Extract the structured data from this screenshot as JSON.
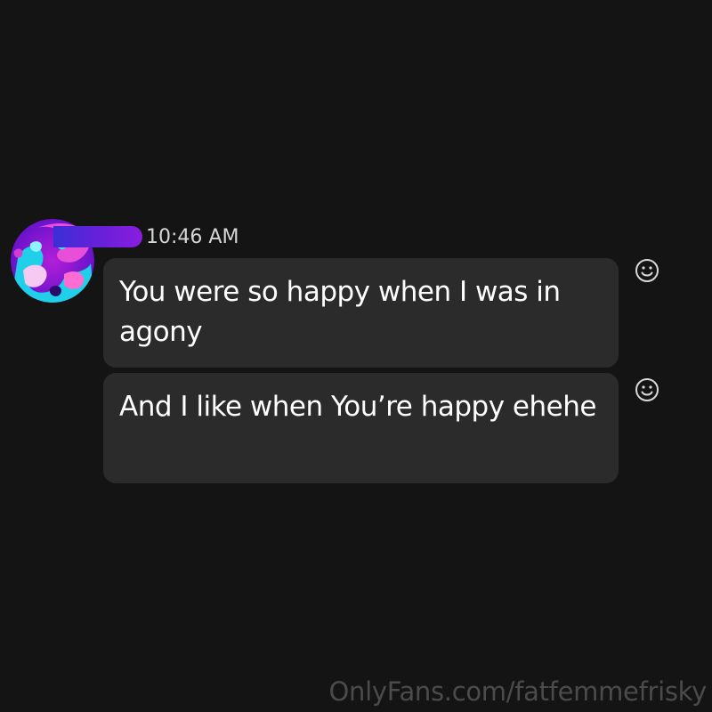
{
  "thread": {
    "timestamp": "10:46 AM",
    "sender_avatar_icon": "abstract-swirl-avatar",
    "messages": [
      {
        "text": "You were so happy when I was in agony",
        "reaction_icon": "smiley-react-icon"
      },
      {
        "text": "And I like when You’re happy ehehe",
        "reaction_icon": "smiley-react-icon"
      }
    ]
  },
  "colors": {
    "background": "#141414",
    "bubble": "#2b2b2b",
    "name_redaction_start": "#3a2fd6",
    "name_redaction_end": "#8a1ee0"
  },
  "watermark": "OnlyFans.com/fatfemmefrisky"
}
